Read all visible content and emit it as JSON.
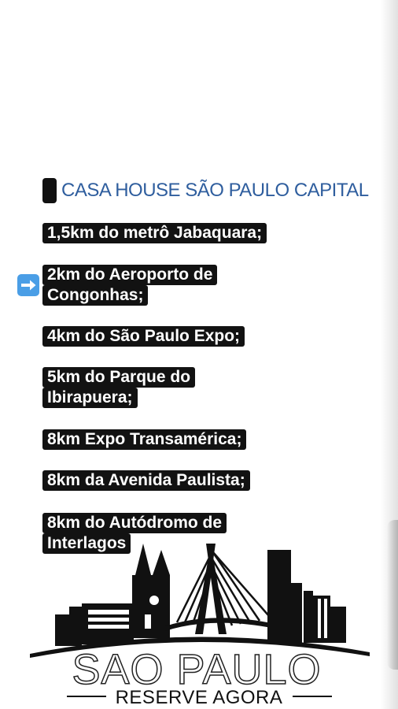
{
  "header": {
    "title": "CASA HOUSE SÃO PAULO CAPITAL"
  },
  "items": [
    {
      "line1": "1,5km do metrô Jabaquara;",
      "line2": ""
    },
    {
      "line1": "2km do Aeroporto de",
      "line2": "Congonhas;"
    },
    {
      "line1": "4km do São Paulo Expo;",
      "line2": ""
    },
    {
      "line1": "5km do Parque do",
      "line2": "Ibirapuera;"
    },
    {
      "line1": "8km Expo Transamérica;",
      "line2": ""
    },
    {
      "line1": "8km da Avenida Paulista;",
      "line2": ""
    },
    {
      "line1": "8km do Autódromo de",
      "line2": "Interlagos"
    }
  ],
  "icons": {
    "arrow": "right-arrow-icon",
    "title_marker": "black-square-icon"
  },
  "logo": {
    "city": "SAO PAULO",
    "cta": "RESERVE AGORA"
  },
  "colors": {
    "title": "#2f5e9e",
    "highlight_bg": "#121212",
    "arrow_bg": "#4a9ee6"
  }
}
